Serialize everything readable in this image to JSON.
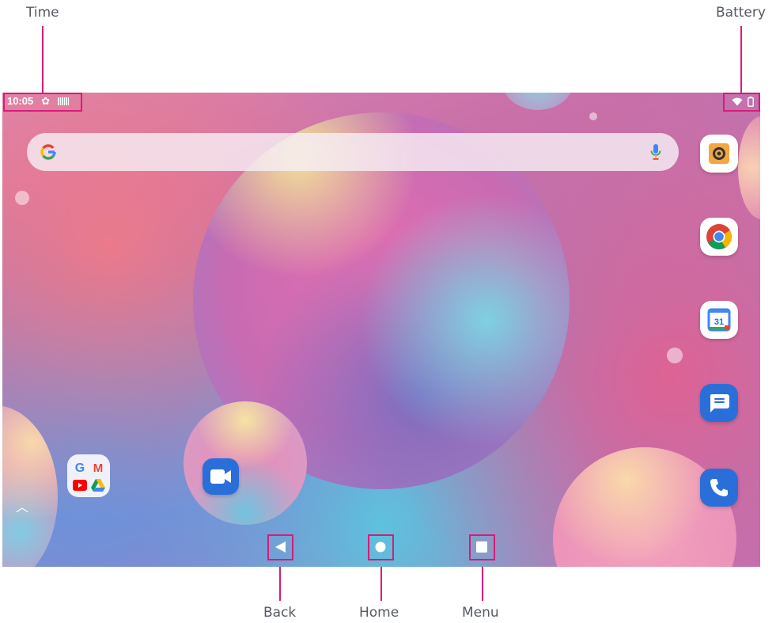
{
  "callouts": {
    "time": "Time",
    "battery": "Battery",
    "back": "Back",
    "home": "Home",
    "menu": "Menu"
  },
  "status_bar": {
    "time": "10:05",
    "icons": [
      "gear-icon",
      "barcode-icon",
      "wifi-icon",
      "battery-icon"
    ]
  },
  "search_bar": {
    "logo": "G",
    "icons": [
      "google-logo-icon",
      "mic-icon"
    ]
  },
  "dock_apps": [
    "camera-app-icon",
    "chrome-app-icon",
    "calendar-app-icon",
    "messages-app-icon",
    "phone-app-icon"
  ],
  "calendar": {
    "day": "31"
  },
  "folder": {
    "apps": [
      "google-app-icon",
      "gmail-app-icon",
      "youtube-app-icon",
      "drive-app-icon"
    ],
    "google_letter": "G",
    "gmail_letter": "M"
  },
  "home_apps": [
    "duo-app-icon"
  ],
  "app_drawer": {
    "icon": "chevron-up-icon",
    "glyph": "︿"
  },
  "nav_bar": {
    "buttons": [
      "back-button",
      "home-button",
      "menu-button"
    ]
  },
  "colors": {
    "callout": "#d81b7a",
    "label_text": "#555a60",
    "app_blue": "#2a6fd9"
  }
}
